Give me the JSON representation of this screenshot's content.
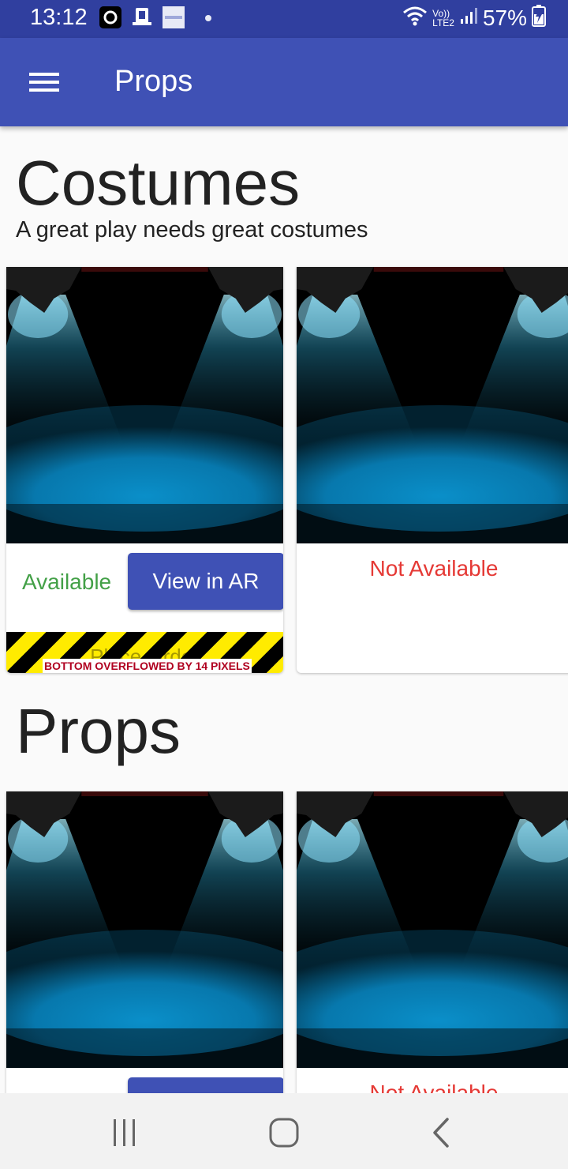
{
  "status_bar": {
    "time": "13:12",
    "network_label": "Vo))\nLTE2",
    "battery_text": "57%",
    "notification_icons": [
      "ola-icon",
      "tray-icon",
      "zomato-icon"
    ]
  },
  "app_bar": {
    "title": "Props",
    "menu_icon": "hamburger-menu-icon"
  },
  "sections": [
    {
      "heading": "Costumes",
      "subtitle": "A great play needs great costumes",
      "cards": [
        {
          "status": "Available",
          "action_label": "View in AR",
          "hidden_label": "Place Order",
          "overflow_text": "BOTTOM OVERFLOWED BY 14 PIXELS"
        },
        {
          "status": "Not Available"
        }
      ]
    },
    {
      "heading": "Props",
      "cards": [
        {
          "action_label": ""
        },
        {
          "status": "Not Available"
        }
      ]
    }
  ],
  "nav_bar": {
    "icons": [
      "recent-apps-icon",
      "home-icon",
      "back-icon"
    ]
  },
  "colors": {
    "primary": "#3f51b5",
    "primary_dark": "#303f9f",
    "available": "#43a047",
    "not_available": "#e53935"
  }
}
